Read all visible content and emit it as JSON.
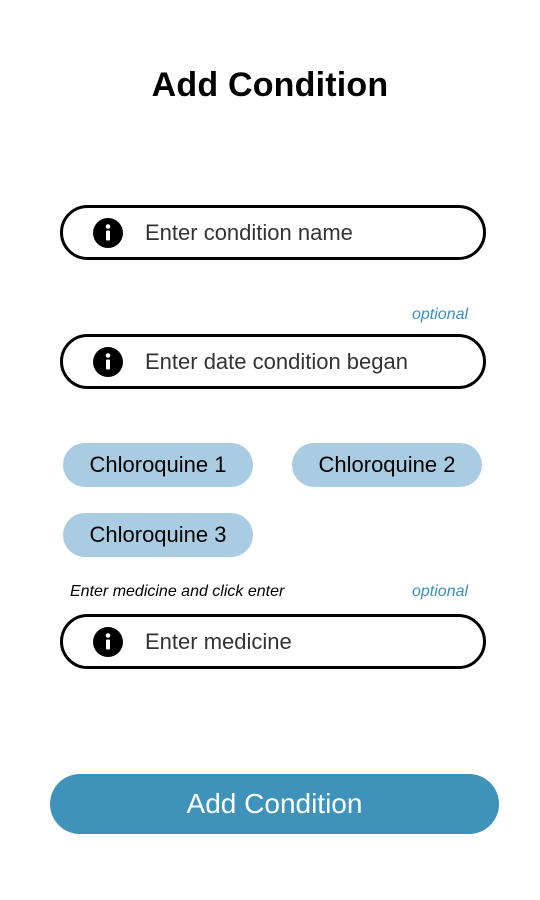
{
  "page": {
    "title": "Add Condition"
  },
  "condition_name": {
    "placeholder": "Enter condition name",
    "icon": "info-icon"
  },
  "date_began": {
    "optional_label": "optional",
    "placeholder": "Enter date condition began",
    "icon": "info-icon"
  },
  "medicines": {
    "chips": [
      "Chloroquine 1",
      "Chloroquine 2",
      "Chloroquine 3"
    ],
    "hint": "Enter medicine and click enter",
    "optional_label": "optional",
    "placeholder": "Enter medicine",
    "icon": "info-icon"
  },
  "submit": {
    "label": "Add Condition"
  },
  "colors": {
    "accent": "#3f93bb",
    "chip_bg": "#a9cce3",
    "optional_text": "#3a8fb6"
  }
}
